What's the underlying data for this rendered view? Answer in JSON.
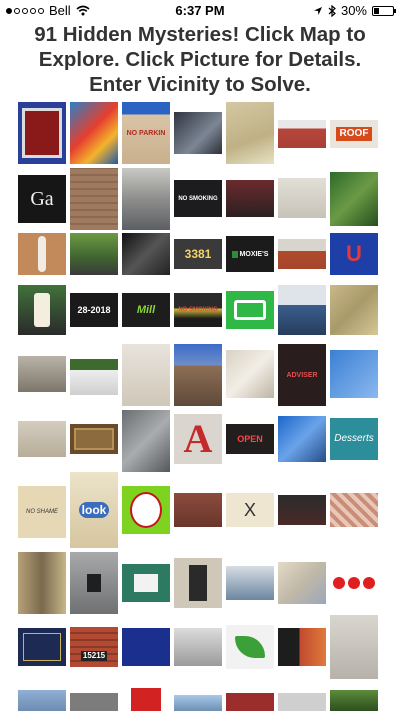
{
  "status_bar": {
    "carrier": "Bell",
    "time": "6:37 PM",
    "battery": "30%",
    "battery_level": 0.3,
    "icons": [
      "signal-dots-icon",
      "wifi-icon",
      "location-arrow-icon",
      "bluetooth-icon",
      "battery-icon"
    ]
  },
  "page": {
    "title": "91 Hidden Mysteries! Click Map to Explore. Click Picture for Details. Enter Vicinity to Solve."
  },
  "photo_texts": {
    "no_parking": "NO PARKIN",
    "roof": "ROOF",
    "no_smoking": "NO SMOKING",
    "ga": "Ga",
    "number_3381": "3381",
    "moxies": "MOXIE'S",
    "date_2018": "28-2018",
    "mill": "Mill",
    "no_smoking_2": "NO SMOKING",
    "advisor": "ADVISER",
    "open": "OPEN",
    "desserts": "Desserts",
    "no_shame": "NO SHAME",
    "look": "look",
    "number_15215": "15215",
    "x_mark": "X"
  }
}
